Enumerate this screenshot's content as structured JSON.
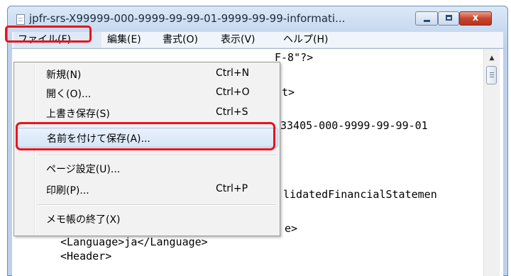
{
  "window": {
    "title": "jpfr-srs-X99999-000-9999-99-99-01-9999-99-99-informati...",
    "buttons": {
      "minimize": "minimize",
      "maximize": "maximize",
      "close": "x"
    }
  },
  "menubar": {
    "file": "ファイル(F)",
    "edit": "編集(E)",
    "format": "書式(O)",
    "view": "表示(V)",
    "help": "ヘルプ(H)"
  },
  "file_menu": {
    "items": [
      {
        "label": "新規(N)",
        "shortcut": "Ctrl+N"
      },
      {
        "label": "開く(O)...",
        "shortcut": "Ctrl+O"
      },
      {
        "label": "上書き保存(S)",
        "shortcut": "Ctrl+S"
      },
      {
        "label": "名前を付けて保存(A)...",
        "shortcut": ""
      },
      {
        "label": "ページ設定(U)...",
        "shortcut": ""
      },
      {
        "label": "印刷(P)...",
        "shortcut": "Ctrl+P"
      },
      {
        "label": "メモ帳の終了(X)",
        "shortcut": ""
      }
    ],
    "selected": "名前を付けて保存(A)..."
  },
  "editor": {
    "visible_fragments": [
      "F-8\"?>",
      "t>",
      "33405-000-9999-99-99-01",
      "lidatedFinancialStatemen",
      "e>",
      "<Language>ja</Language>",
      "<Header>"
    ]
  },
  "colors": {
    "annotation": "#e8141c",
    "title_bar": "#c6d9ef",
    "menu_background": "#f2f2f2",
    "selection": "#d6e5f7"
  },
  "icons": [
    "notepad-icon",
    "scroll-up-icon",
    "scroll-thumb-grip-icon"
  ]
}
